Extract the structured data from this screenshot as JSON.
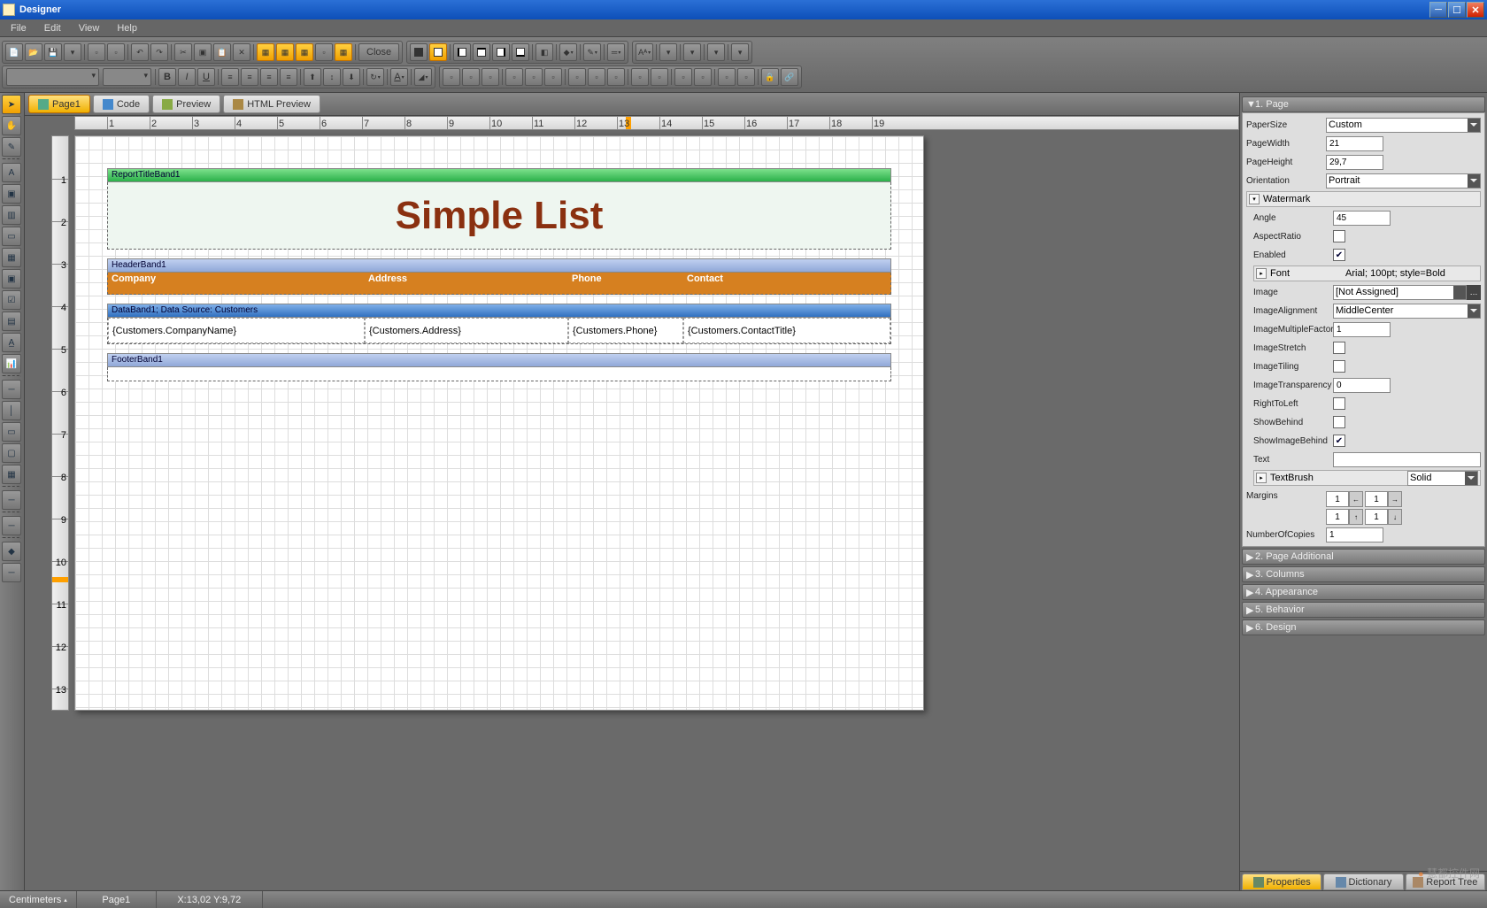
{
  "app": {
    "title": "Designer"
  },
  "menu": [
    "File",
    "Edit",
    "View",
    "Help"
  ],
  "toolbar_close": "Close",
  "tabs": {
    "page": "Page1",
    "code": "Code",
    "preview": "Preview",
    "html_preview": "HTML Preview"
  },
  "report": {
    "title_band_label": "ReportTitleBand1",
    "title_text": "Simple List",
    "header_band_label": "HeaderBand1",
    "columns": {
      "company": "Company",
      "address": "Address",
      "phone": "Phone",
      "contact": "Contact"
    },
    "data_band_label": "DataBand1; Data Source: Customers",
    "fields": {
      "company": "{Customers.CompanyName}",
      "address": "{Customers.Address}",
      "phone": "{Customers.Phone}",
      "contact": "{Customers.ContactTitle}"
    },
    "footer_band_label": "FooterBand1"
  },
  "props": {
    "section1": "1. Page",
    "PaperSize_lbl": "PaperSize",
    "PaperSize": "Custom",
    "PageWidth_lbl": "PageWidth",
    "PageWidth": "21",
    "PageHeight_lbl": "PageHeight",
    "PageHeight": "29,7",
    "Orientation_lbl": "Orientation",
    "Orientation": "Portrait",
    "Watermark_lbl": "Watermark",
    "Angle_lbl": "Angle",
    "Angle": "45",
    "AspectRatio_lbl": "AspectRatio",
    "Enabled_lbl": "Enabled",
    "Font_lbl": "Font",
    "Font": "Arial; 100pt; style=Bold",
    "Image_lbl": "Image",
    "Image": "[Not Assigned]",
    "ImageAlignment_lbl": "ImageAlignment",
    "ImageAlignment": "MiddleCenter",
    "ImageMultipleFactor_lbl": "ImageMultipleFactor",
    "ImageMultipleFactor": "1",
    "ImageStretch_lbl": "ImageStretch",
    "ImageTiling_lbl": "ImageTiling",
    "ImageTransparency_lbl": "ImageTransparency",
    "ImageTransparency": "0",
    "RightToLeft_lbl": "RightToLeft",
    "ShowBehind_lbl": "ShowBehind",
    "ShowImageBehind_lbl": "ShowImageBehind",
    "Text_lbl": "Text",
    "Text": "",
    "TextBrush_lbl": "TextBrush",
    "TextBrush": "Solid",
    "Margins_lbl": "Margins",
    "Margins": {
      "a": "1",
      "b": "1",
      "c": "1",
      "d": "1"
    },
    "NumberOfCopies_lbl": "NumberOfCopies",
    "NumberOfCopies": "1",
    "section2": "2. Page Additional",
    "section3": "3. Columns",
    "section4": "4. Appearance",
    "section5": "5. Behavior",
    "section6": "6. Design"
  },
  "rtabs": {
    "properties": "Properties",
    "dictionary": "Dictionary",
    "reporttree": "Report Tree"
  },
  "status": {
    "unit": "Centimeters",
    "page": "Page1",
    "coords": "X:13,02 Y:9,72"
  },
  "ruler_marks": [
    "1",
    "2",
    "3",
    "4",
    "5",
    "6",
    "7",
    "8",
    "9",
    "10",
    "11",
    "12",
    "13",
    "14",
    "15",
    "16",
    "17",
    "18",
    "19"
  ]
}
